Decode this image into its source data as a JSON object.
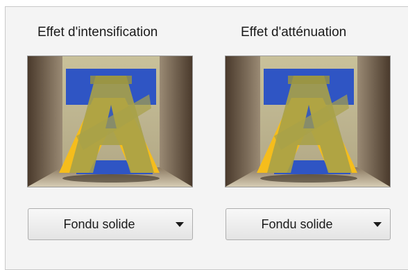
{
  "effects": [
    {
      "title": "Effet d'intensification",
      "preview_icon": "letter-a-transition-preview-icon",
      "selected_option": "Fondu solide"
    },
    {
      "title": "Effet d'atténuation",
      "preview_icon": "letter-a-transition-preview-icon",
      "selected_option": "Fondu solide"
    }
  ],
  "colors": {
    "panel_background": "#f4f4f4",
    "letter_blue": "#2f55c4",
    "letter_yellow": "#f5bd1c",
    "overlay_olive": "#a8a148"
  }
}
